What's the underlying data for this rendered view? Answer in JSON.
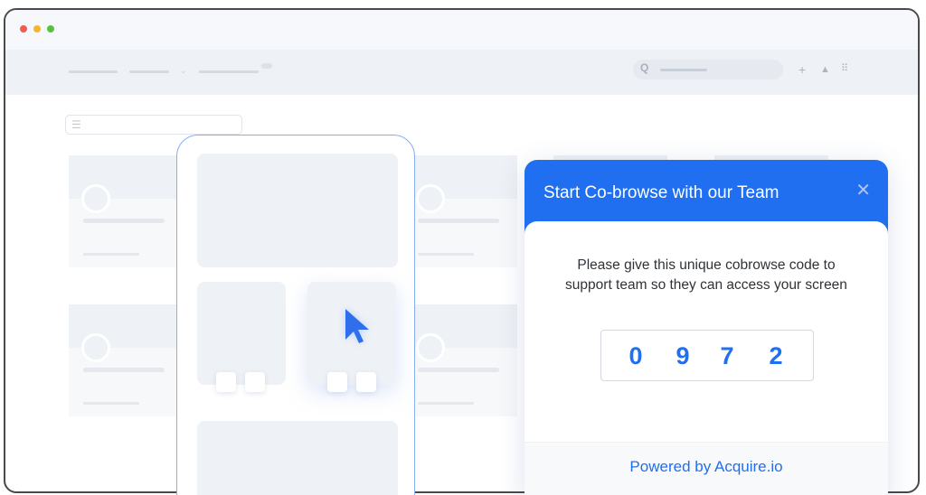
{
  "dialog": {
    "title": "Start Co-browse with our Team",
    "message_line1": "Please give this unique cobrowse code to",
    "message_line2": "support team so they can access your screen",
    "code_digits": [
      "0",
      "9",
      "7",
      "2"
    ],
    "footer_link": "Powered by Acquire.io",
    "close_glyph": "✕"
  },
  "icons": {
    "search": "search-icon",
    "add": "plus-icon",
    "notifications": "bell-icon",
    "apps": "grid-icon",
    "filter": "filter-icon",
    "close": "close-icon",
    "cursor": "mouse-pointer-icon"
  },
  "colors": {
    "accent": "#1f6ff0",
    "phone_outline": "#86aef0",
    "traffic_red": "#ee5c54",
    "traffic_yellow": "#f2b431",
    "traffic_green": "#57c23e"
  }
}
